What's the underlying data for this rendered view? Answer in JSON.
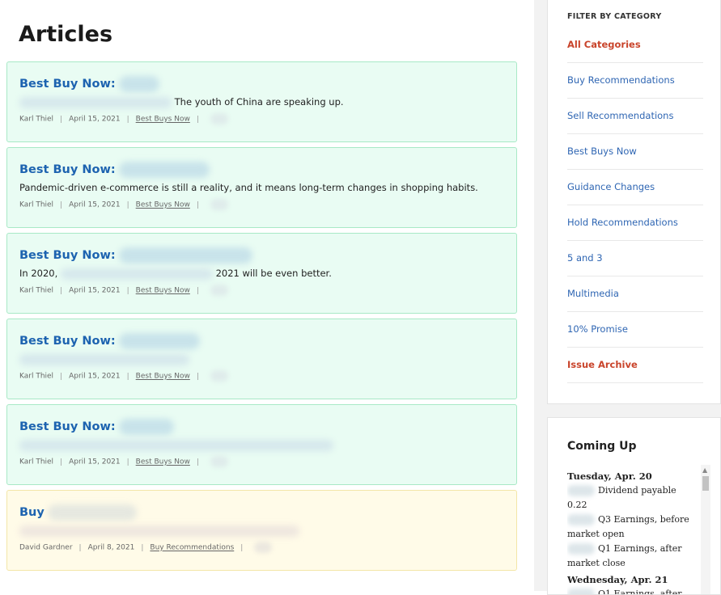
{
  "page": {
    "title": "Articles"
  },
  "articles": [
    {
      "title_prefix": "Best Buy Now:",
      "summary": "The youth of China are speaking up.",
      "author": "Karl Thiel",
      "date": "April 15, 2021",
      "category": "Best Buys Now",
      "style": "green"
    },
    {
      "title_prefix": "Best Buy Now:",
      "summary": "Pandemic-driven e-commerce is still a reality, and it means long-term changes in shopping habits.",
      "author": "Karl Thiel",
      "date": "April 15, 2021",
      "category": "Best Buys Now",
      "style": "green"
    },
    {
      "title_prefix": "Best Buy Now:",
      "summary_start": "In 2020,",
      "summary_end": "2021 will be even better.",
      "author": "Karl Thiel",
      "date": "April 15, 2021",
      "category": "Best Buys Now",
      "style": "green"
    },
    {
      "title_prefix": "Best Buy Now:",
      "author": "Karl Thiel",
      "date": "April 15, 2021",
      "category": "Best Buys Now",
      "style": "green"
    },
    {
      "title_prefix": "Best Buy Now:",
      "author": "Karl Thiel",
      "date": "April 15, 2021",
      "category": "Best Buys Now",
      "style": "green"
    },
    {
      "title_prefix": "Buy",
      "author": "David Gardner",
      "date": "April 8, 2021",
      "category": "Buy Recommendations",
      "style": "yellow"
    }
  ],
  "sidebar": {
    "filter": {
      "heading": "FILTER BY CATEGORY",
      "items": [
        {
          "label": "All Categories",
          "accent": true
        },
        {
          "label": "Buy Recommendations",
          "accent": false
        },
        {
          "label": "Sell Recommendations",
          "accent": false
        },
        {
          "label": "Best Buys Now",
          "accent": false
        },
        {
          "label": "Guidance Changes",
          "accent": false
        },
        {
          "label": "Hold Recommendations",
          "accent": false
        },
        {
          "label": "5 and 3",
          "accent": false
        },
        {
          "label": "Multimedia",
          "accent": false
        },
        {
          "label": "10% Promise",
          "accent": false
        },
        {
          "label": "Issue Archive",
          "accent": true
        }
      ]
    },
    "coming_up": {
      "title": "Coming Up",
      "days": [
        {
          "label": "Tuesday, Apr. 20",
          "events": [
            "Dividend payable 0.22",
            "Q3 Earnings, before market open",
            "Q1 Earnings, after market close"
          ]
        },
        {
          "label": "Wednesday, Apr. 21",
          "events": [
            "Q1 Earnings, after"
          ]
        }
      ]
    }
  },
  "icons": {
    "scroll_up": "triangle-up-icon"
  },
  "colors": {
    "link_blue": "#1d63b0",
    "accent_red": "#c9442b",
    "card_green_bg": "#e9fcf3",
    "card_green_border": "#a8e9c6",
    "card_yellow_bg": "#fffbe8",
    "card_yellow_border": "#f3e6a8"
  }
}
